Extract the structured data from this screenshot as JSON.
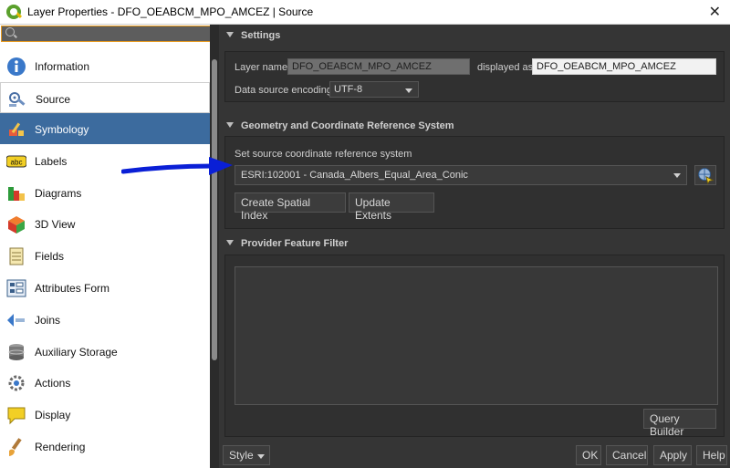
{
  "window": {
    "title": "Layer Properties - DFO_OEABCM_MPO_AMCEZ | Source",
    "close_glyph": "✕"
  },
  "sidebar": {
    "items": [
      {
        "label": "Information",
        "icon": "info-icon",
        "state": "normal"
      },
      {
        "label": "Source",
        "icon": "source-icon",
        "state": "selected"
      },
      {
        "label": "Symbology",
        "icon": "symbology-icon",
        "state": "highlighted"
      },
      {
        "label": "Labels",
        "icon": "labels-icon",
        "state": "normal"
      },
      {
        "label": "Diagrams",
        "icon": "diagrams-icon",
        "state": "normal"
      },
      {
        "label": "3D View",
        "icon": "3d-view-icon",
        "state": "normal"
      },
      {
        "label": "Fields",
        "icon": "fields-icon",
        "state": "normal"
      },
      {
        "label": "Attributes Form",
        "icon": "attributes-form-icon",
        "state": "normal"
      },
      {
        "label": "Joins",
        "icon": "joins-icon",
        "state": "normal"
      },
      {
        "label": "Auxiliary Storage",
        "icon": "auxiliary-storage-icon",
        "state": "normal"
      },
      {
        "label": "Actions",
        "icon": "actions-icon",
        "state": "normal"
      },
      {
        "label": "Display",
        "icon": "display-icon",
        "state": "normal"
      },
      {
        "label": "Rendering",
        "icon": "rendering-icon",
        "state": "normal"
      }
    ],
    "labels_icon_text": "abc"
  },
  "settings": {
    "header": "Settings",
    "layer_name_label": "Layer name",
    "layer_name_value": "DFO_OEABCM_MPO_AMCEZ",
    "displayed_as_label": "displayed as",
    "displayed_as_value": "DFO_OEABCM_MPO_AMCEZ",
    "encoding_label": "Data source encoding",
    "encoding_value": "UTF-8"
  },
  "geometry": {
    "header": "Geometry and Coordinate Reference System",
    "crs_label": "Set source coordinate reference system",
    "crs_value": "ESRI:102001 - Canada_Albers_Equal_Area_Conic",
    "spatial_index_button": "Create Spatial Index",
    "update_extents_button": "Update Extents"
  },
  "filter": {
    "header": "Provider Feature Filter",
    "query_builder_button": "Query Builder"
  },
  "footer": {
    "style_label": "Style",
    "ok": "OK",
    "cancel": "Cancel",
    "apply": "Apply",
    "help": "Help"
  },
  "colors": {
    "selection_blue": "#3c6b9e",
    "annotation_arrow": "#0a1fd6",
    "search_focus": "#e59a21"
  }
}
